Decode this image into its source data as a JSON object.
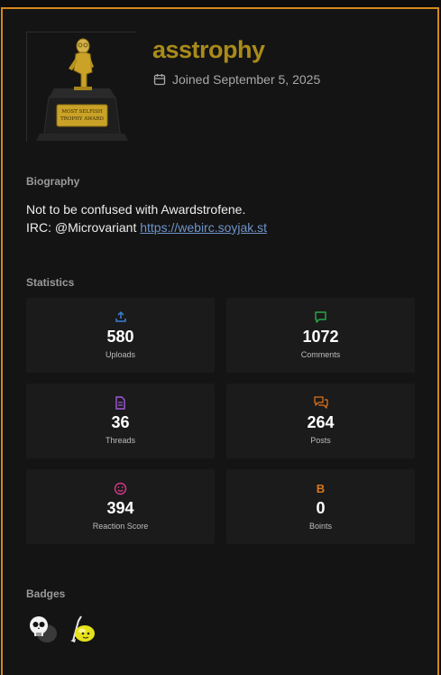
{
  "profile": {
    "username": "asstrophy",
    "joined": "Joined September 5, 2025",
    "avatar": {
      "plaque_line1": "MOST SELFISH",
      "plaque_line2": "TROPHY AWARD"
    }
  },
  "biography": {
    "heading": "Biography",
    "line1": "Not to be confused with Awardstrofene.",
    "line2_prefix": "IRC: @Microvariant",
    "link_text": "https://webirc.soyjak.st"
  },
  "statistics": {
    "heading": "Statistics",
    "items": [
      {
        "value": "580",
        "label": "Uploads",
        "icon": "upload-icon",
        "color": "#3a7fd5"
      },
      {
        "value": "1072",
        "label": "Comments",
        "icon": "comment-icon",
        "color": "#2aa84a"
      },
      {
        "value": "36",
        "label": "Threads",
        "icon": "document-icon",
        "color": "#a05ad8"
      },
      {
        "value": "264",
        "label": "Posts",
        "icon": "posts-icon",
        "color": "#d9701c"
      },
      {
        "value": "394",
        "label": "Reaction Score",
        "icon": "smiley-icon",
        "color": "#d63a8a"
      },
      {
        "value": "0",
        "label": "Boints",
        "icon": "boints-icon",
        "glyph": "B",
        "color": "#d9791c"
      }
    ]
  },
  "badges": {
    "heading": "Badges",
    "items": [
      "skull-badge-icon",
      "lemon-badge-icon"
    ]
  }
}
